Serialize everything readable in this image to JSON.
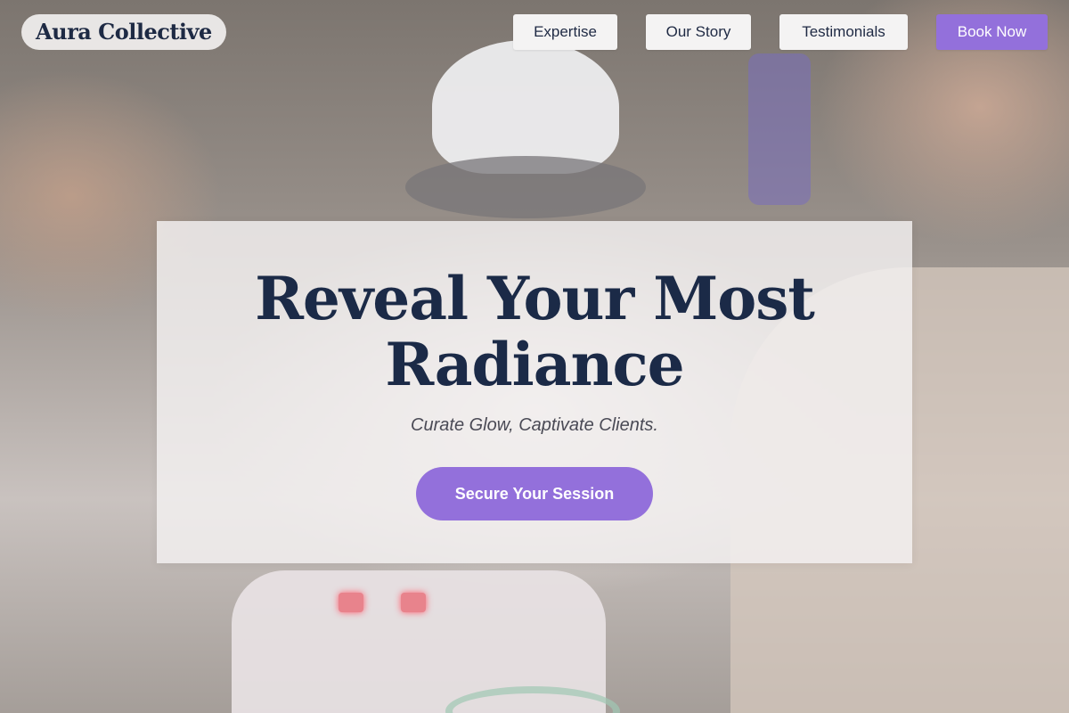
{
  "brand": {
    "name": "Aura Collective"
  },
  "nav": {
    "items": [
      {
        "label": "Expertise"
      },
      {
        "label": "Our Story"
      },
      {
        "label": "Testimonials"
      }
    ],
    "cta_label": "Book Now"
  },
  "hero": {
    "title_line1": "Reveal Your Most",
    "title_line2": "Radiance",
    "subtitle": "Curate Glow, Captivate Clients.",
    "cta_label": "Secure Your Session"
  },
  "colors": {
    "accent": "#9370db",
    "heading": "#1b2a47",
    "nav_button_bg": "#f4f3f3"
  }
}
